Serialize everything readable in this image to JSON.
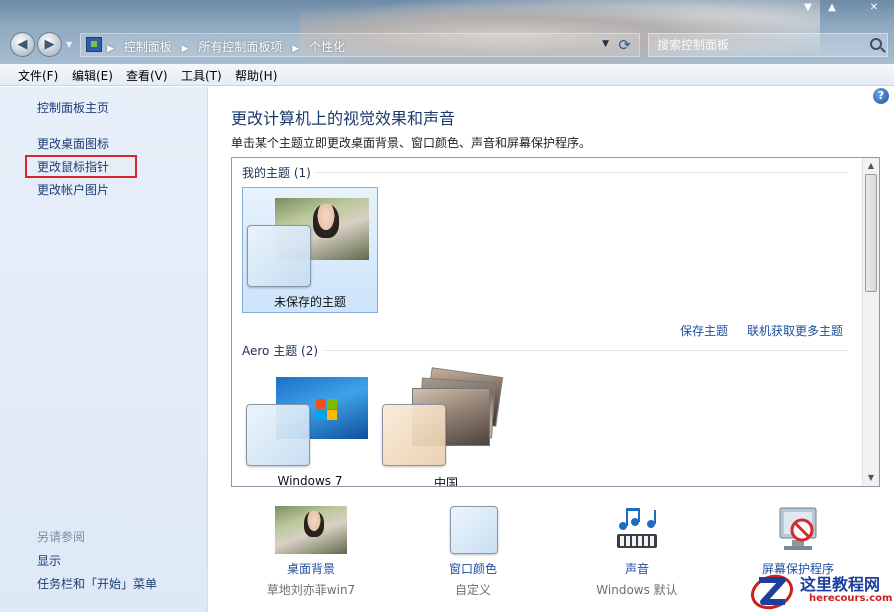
{
  "window": {
    "minimize_glyph": "▼",
    "maximize_glyph": "▲",
    "close_glyph": "✕"
  },
  "address": {
    "crumbs": [
      "控制面板",
      "所有控制面板项",
      "个性化"
    ],
    "search_placeholder": "搜索控制面板"
  },
  "menu": [
    "文件(F)",
    "编辑(E)",
    "查看(V)",
    "工具(T)",
    "帮助(H)"
  ],
  "sidebar": {
    "home": "控制面板主页",
    "links": [
      "更改桌面图标",
      "更改鼠标指针",
      "更改帐户图片"
    ],
    "see_also": "另请参阅",
    "see_also_links": [
      "显示",
      "任务栏和「开始」菜单"
    ]
  },
  "main": {
    "title": "更改计算机上的视觉效果和声音",
    "description": "单击某个主题立即更改桌面背景、窗口颜色、声音和屏幕保护程序。",
    "help_glyph": "?"
  },
  "themes": {
    "my_themes_header": "我的主题 (1)",
    "my_themes": [
      {
        "label": "未保存的主题"
      }
    ],
    "save_theme": "保存主题",
    "more_themes": "联机获取更多主题",
    "aero_header": "Aero 主题 (2)",
    "aero_themes": [
      {
        "label": "Windows 7"
      },
      {
        "label": "中国"
      }
    ]
  },
  "settings": [
    {
      "name": "桌面背景",
      "sub": "草地刘亦菲win7",
      "icon": "desktop-background-icon"
    },
    {
      "name": "窗口颜色",
      "sub": "自定义",
      "icon": "window-color-icon"
    },
    {
      "name": "声音",
      "sub": "Windows 默认",
      "icon": "sound-icon"
    },
    {
      "name": "屏幕保护程序",
      "sub": "",
      "icon": "screensaver-icon"
    }
  ],
  "watermark": {
    "text": "这里教程网",
    "url": "herecours.com"
  },
  "colors": {
    "link": "#1f4e9e",
    "highlight": "#d9262b",
    "title": "#1d3a6e"
  }
}
